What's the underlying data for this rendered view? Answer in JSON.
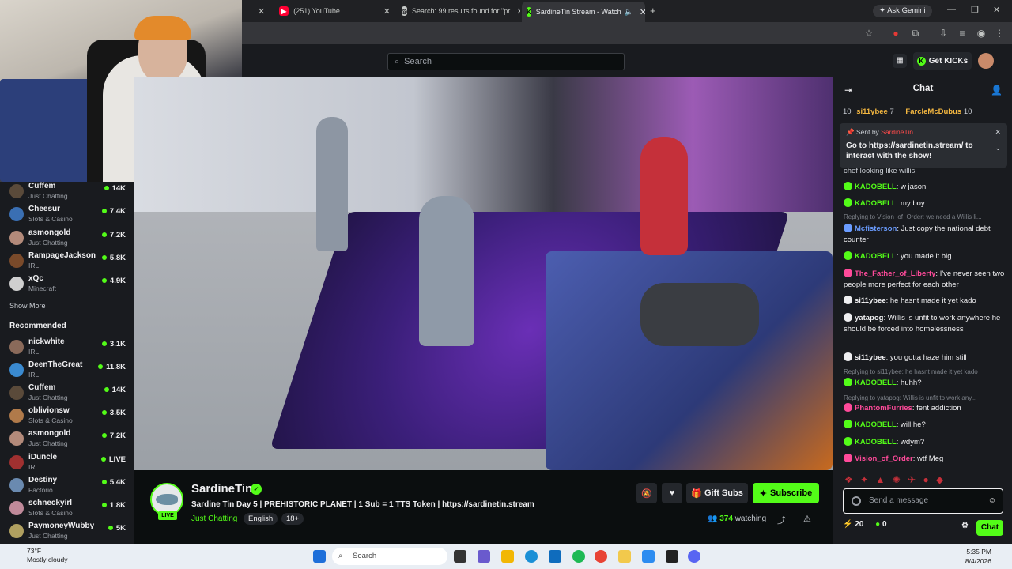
{
  "browser": {
    "tabs": [
      {
        "title": "(251) YouTube",
        "active": false
      },
      {
        "title": "Search: 99 results found for \"pr",
        "active": false
      },
      {
        "title": "SardineTin Stream - Watch",
        "active": true
      }
    ],
    "ask_gemini": "Ask Gemini"
  },
  "header": {
    "search_placeholder": "Search",
    "get_kicks": "Get KICKs"
  },
  "sidebar": {
    "following": [
      {
        "name": "Cuffem",
        "category": "Just Chatting",
        "viewers": "14K",
        "color": "#5a4a3a"
      },
      {
        "name": "Cheesur",
        "category": "Slots & Casino",
        "viewers": "7.4K",
        "color": "#3a6fb3"
      },
      {
        "name": "asmongold",
        "category": "Just Chatting",
        "viewers": "7.2K",
        "color": "#b38a7a"
      },
      {
        "name": "RampageJackson",
        "category": "IRL",
        "viewers": "5.8K",
        "color": "#7a4a2a"
      },
      {
        "name": "xQc",
        "category": "Minecraft",
        "viewers": "4.9K",
        "color": "#cfcfcf"
      }
    ],
    "show_more": "Show More",
    "recommended_title": "Recommended",
    "recommended": [
      {
        "name": "nickwhite",
        "category": "IRL",
        "viewers": "3.1K",
        "color": "#8a6a5a"
      },
      {
        "name": "DeenTheGreat",
        "category": "IRL",
        "viewers": "11.8K",
        "color": "#3a8ad0"
      },
      {
        "name": "Cuffem",
        "category": "Just Chatting",
        "viewers": "14K",
        "color": "#5a4a3a"
      },
      {
        "name": "oblivionsw",
        "category": "Slots & Casino",
        "viewers": "3.5K",
        "color": "#b07a4a"
      },
      {
        "name": "asmongold",
        "category": "Just Chatting",
        "viewers": "7.2K",
        "color": "#b38a7a"
      },
      {
        "name": "iDuncle",
        "category": "IRL",
        "viewers": "LIVE",
        "color": "#a03030"
      },
      {
        "name": "Destiny",
        "category": "Factorio",
        "viewers": "5.4K",
        "color": "#6a8ab0"
      },
      {
        "name": "schneckyirl",
        "category": "Slots & Casino",
        "viewers": "1.8K",
        "color": "#c08a9a"
      },
      {
        "name": "PaymoneyWubby",
        "category": "Just Chatting",
        "viewers": "5K",
        "color": "#b0a060"
      }
    ]
  },
  "stream": {
    "name": "SardineTin",
    "live": "LIVE",
    "title": "Sardine Tin Day 5 | PREHISTORIC PLANET | 1 Sub = 1 TTS Token | https://sardinetin.stream",
    "category": "Just Chatting",
    "tags": [
      "English",
      "18+"
    ],
    "gift_subs": "Gift Subs",
    "subscribe": "Subscribe",
    "viewers": "374",
    "watching": "watching"
  },
  "chat": {
    "title": "Chat",
    "leaderboard": {
      "rank": "10",
      "user1": "si11ybee",
      "count1": "7",
      "user2": "FarcleMcDubus",
      "count2": "10"
    },
    "pinned": {
      "sent_by_label": "Sent by",
      "sent_by": "SardineTin",
      "text_pre": "Go to ",
      "link": "https://sardinetin.stream/",
      "text_post": " to interact with the show!"
    },
    "partial_line": "chef looking like willis",
    "messages": [
      {
        "reply": "",
        "user": "KADOBELL",
        "color": "#53fc18",
        "text": ": w jason"
      },
      {
        "reply": "",
        "user": "KADOBELL",
        "color": "#53fc18",
        "text": ": my boy"
      },
      {
        "reply": "Replying to Vision_of_Order: we need a Willis li...",
        "user": "Mcfisterson",
        "color": "#6a9cff",
        "text": ": Just copy the national debt counter"
      },
      {
        "reply": "",
        "user": "KADOBELL",
        "color": "#53fc18",
        "text": ": you made it big"
      },
      {
        "reply": "",
        "user": "The_Father_of_Liberty",
        "color": "#ff4a9a",
        "text": ": I've never seen two people more perfect for each other"
      },
      {
        "reply": "",
        "user": "si11ybee",
        "color": "#efeff1",
        "text": ": he hasnt made it yet kado"
      },
      {
        "reply": "",
        "user": "yatapog",
        "color": "#efeff1",
        "text": ": Willis is unfit to work anywhere he should be forced into homelessness"
      },
      {
        "reply": "",
        "user": "si11ybee",
        "color": "#efeff1",
        "text": ": you gotta haze him still"
      },
      {
        "reply": "Replying to si11ybee: he hasnt made it yet kado",
        "user": "KADOBELL",
        "color": "#53fc18",
        "text": ": huhh?"
      },
      {
        "reply": "Replying to yatapog: Willis is unfit to work any...",
        "user": "PhantomFurries",
        "color": "#ff4a9a",
        "text": ": fent addiction"
      },
      {
        "reply": "",
        "user": "KADOBELL",
        "color": "#53fc18",
        "text": ": will he?"
      },
      {
        "reply": "",
        "user": "KADOBELL",
        "color": "#53fc18",
        "text": ": wdym?"
      },
      {
        "reply": "",
        "user": "Vision_of_Order",
        "color": "#ff4a9a",
        "text": ": wtf Meg"
      }
    ],
    "input_placeholder": "Send a message",
    "footer_points": "20",
    "footer_kicks": "0",
    "send": "Chat"
  },
  "taskbar": {
    "temp": "73°F",
    "weather": "Mostly cloudy",
    "search": "Search",
    "time": "5:35 PM",
    "date": "8/4/2026"
  }
}
